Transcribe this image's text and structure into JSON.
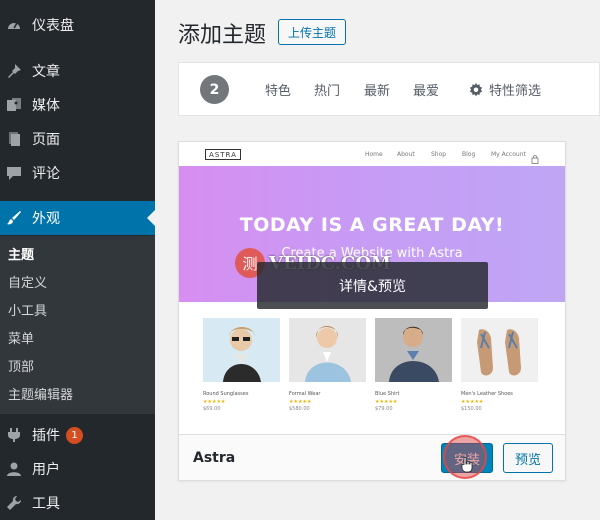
{
  "sidebar": {
    "items": [
      {
        "label": "仪表盘",
        "icon": "dashboard-icon"
      },
      {
        "label": "文章",
        "icon": "pin-icon"
      },
      {
        "label": "媒体",
        "icon": "media-icon"
      },
      {
        "label": "页面",
        "icon": "page-icon"
      },
      {
        "label": "评论",
        "icon": "comment-icon"
      },
      {
        "label": "外观",
        "icon": "brush-icon"
      },
      {
        "label": "插件",
        "icon": "plugin-icon",
        "badge": "1"
      },
      {
        "label": "用户",
        "icon": "user-icon"
      },
      {
        "label": "工具",
        "icon": "wrench-icon"
      }
    ],
    "submenu": [
      "主题",
      "自定义",
      "小工具",
      "菜单",
      "顶部",
      "主题编辑器"
    ]
  },
  "header": {
    "title": "添加主题",
    "upload_label": "上传主题"
  },
  "filter_bar": {
    "count": "2",
    "links": [
      "特色",
      "热门",
      "最新",
      "最爱"
    ],
    "feature_filter_label": "特性筛选"
  },
  "theme_card": {
    "name": "Astra",
    "install_label": "安装",
    "preview_label": "预览",
    "overlay_label": "详情&预览",
    "screenshot": {
      "logo": "ASTRA",
      "nav": [
        "Home",
        "About",
        "Shop",
        "Blog",
        "My Account"
      ],
      "hero_title": "TODAY IS A GREAT DAY!",
      "hero_subtitle": "Create a Website with Astra",
      "watermark_char": "测",
      "watermark_text": "VEIDC.COM",
      "products": [
        {
          "name": "Round Sunglasses",
          "stars": "★★★★★",
          "price": "$69.00"
        },
        {
          "name": "Formal Wear",
          "stars": "★★★★★",
          "price": "$580.00"
        },
        {
          "name": "Blue Shirt",
          "stars": "★★★★★",
          "price": "$79.00"
        },
        {
          "name": "Men's Leather Shoes",
          "stars": "★★★★★",
          "price": "$150.00"
        }
      ]
    }
  },
  "colors": {
    "accent": "#0073aa",
    "sidebar": "#23282d",
    "badge": "#d54e21"
  }
}
